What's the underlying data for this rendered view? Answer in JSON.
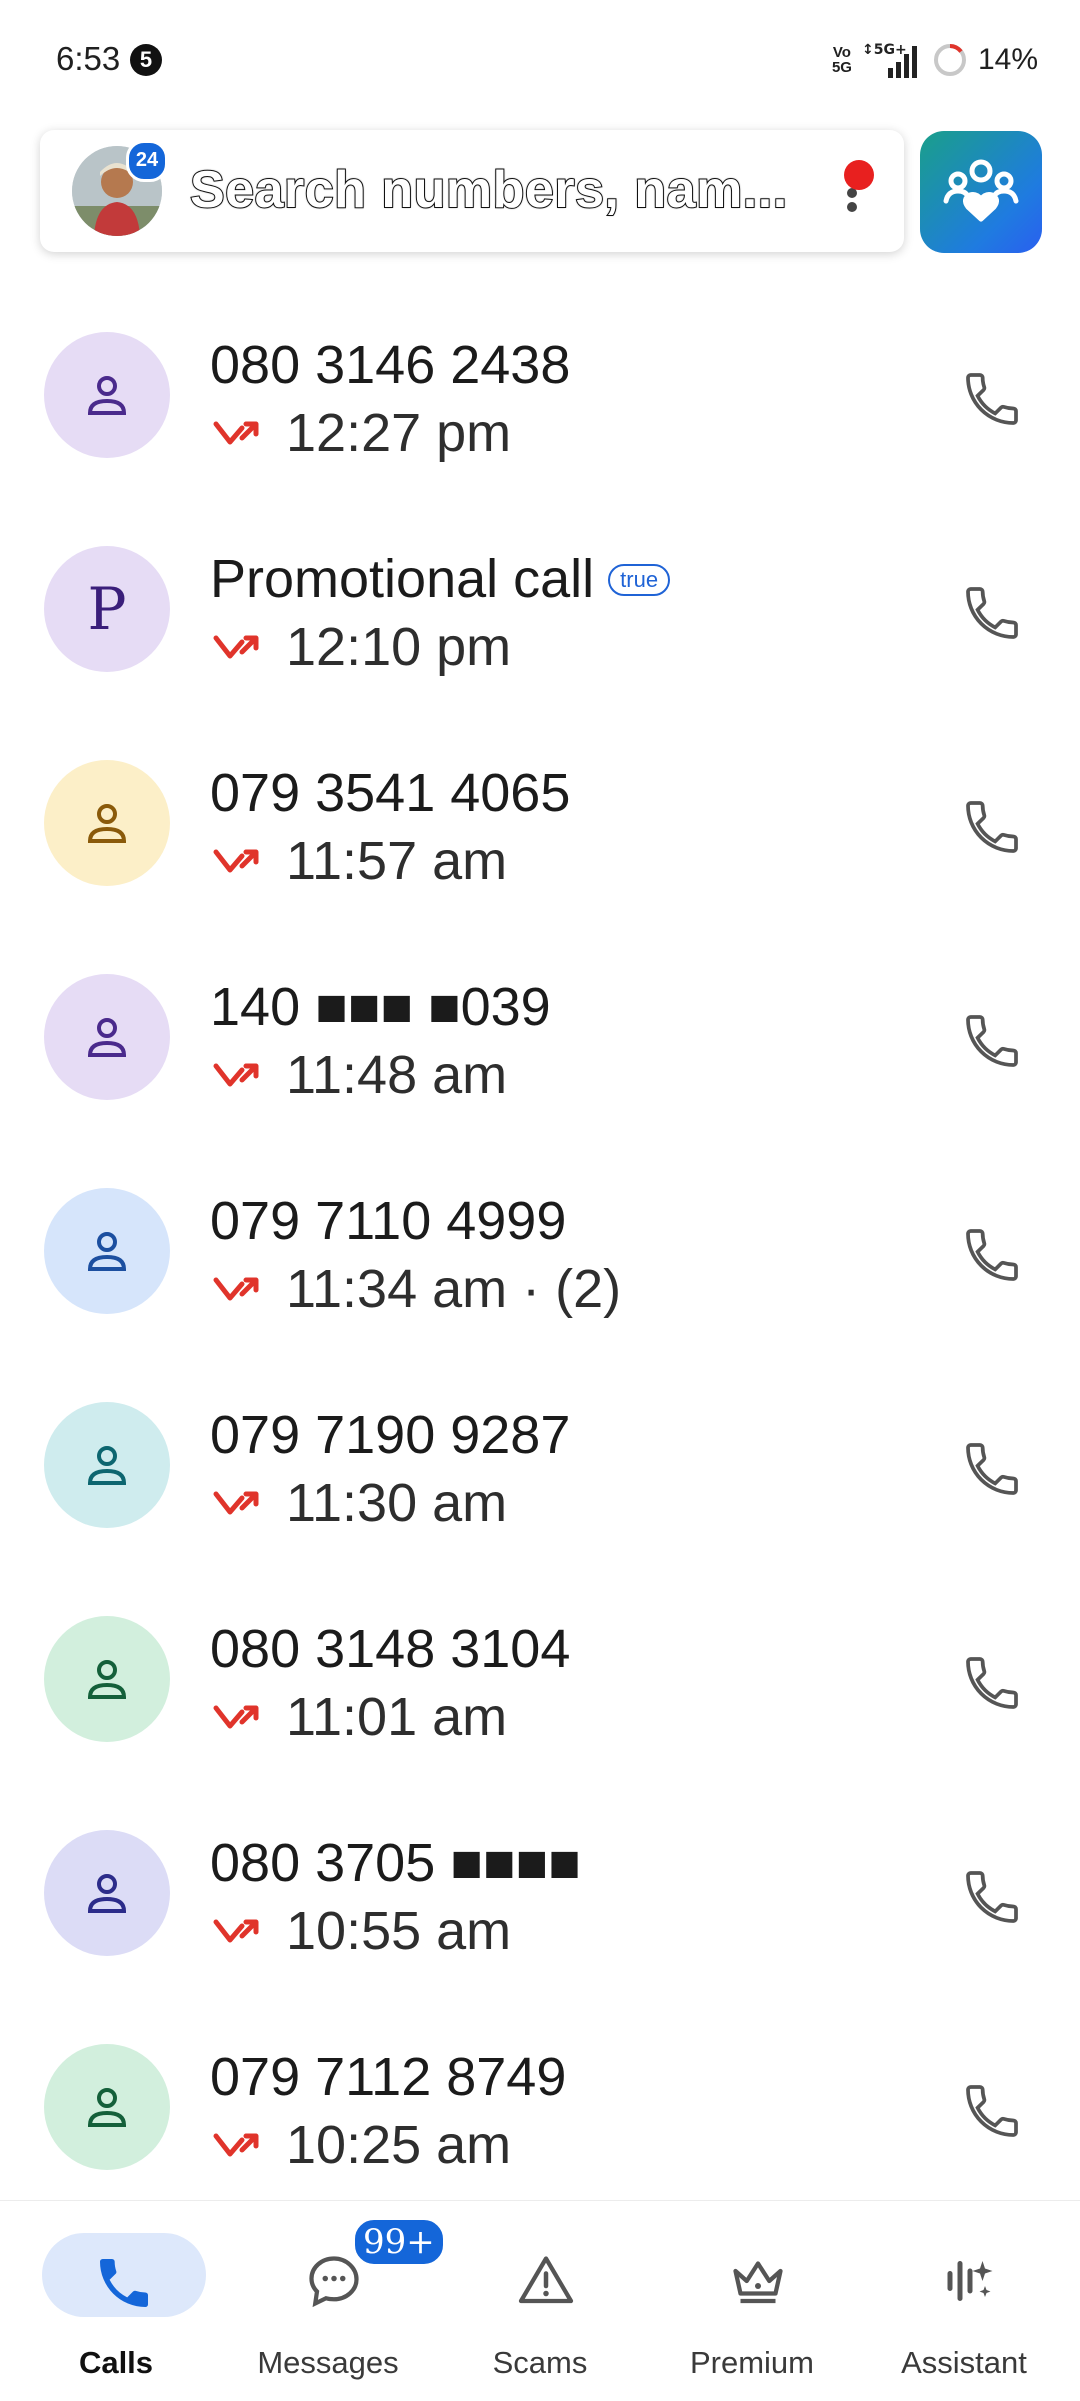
{
  "status_bar": {
    "time": "6:53",
    "notification_count": "5",
    "network": "5G+",
    "battery": "14%"
  },
  "search": {
    "avatar_badge": "24",
    "placeholder": "Search numbers, nam..."
  },
  "calls": [
    {
      "title": "080 3146 2438",
      "time": "12:27 pm"
    },
    {
      "title": "Promotional call",
      "badge": "true",
      "time": "12:10 pm",
      "initial": "P"
    },
    {
      "title": "079 3541 4065",
      "time": "11:57 am"
    },
    {
      "title": "140 ■■■ ■039",
      "time": "11:48 am"
    },
    {
      "title": "079 7110 4999",
      "time": "11:34 am · (2)"
    },
    {
      "title": "079 7190 9287",
      "time": "11:30 am"
    },
    {
      "title": "080 3148 3104",
      "time": "11:01 am"
    },
    {
      "title": "080 3705 ■■■■",
      "time": "10:55 am"
    },
    {
      "title": "079 7112 8749",
      "time": "10:25 am"
    }
  ],
  "nav": {
    "calls": "Calls",
    "messages": "Messages",
    "messages_badge": "99+",
    "scams": "Scams",
    "premium": "Premium",
    "assistant": "Assistant"
  },
  "colors": {
    "accent": "#1466d9",
    "missed": "#e0342b"
  }
}
